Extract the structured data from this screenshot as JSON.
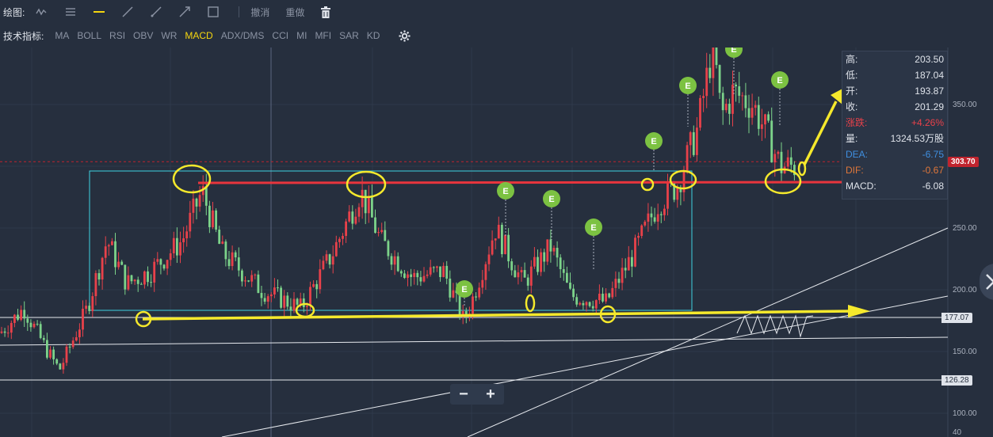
{
  "toolbar_draw": {
    "label": "绘图:",
    "tools": [
      {
        "name": "line-chart-icon"
      },
      {
        "name": "multi-line-icon"
      },
      {
        "name": "horizontal-line-icon",
        "active_color": "#f5d60f"
      },
      {
        "name": "trend-line-icon"
      },
      {
        "name": "ray-icon"
      },
      {
        "name": "arrow-line-icon"
      },
      {
        "name": "rectangle-icon"
      }
    ],
    "undo": "撤消",
    "redo": "重做",
    "delete_icon": "trash-icon"
  },
  "toolbar_indicators": {
    "label": "技术指标:",
    "items": [
      "MA",
      "BOLL",
      "RSI",
      "OBV",
      "WR",
      "MACD",
      "ADX/DMS",
      "CCI",
      "MI",
      "MFI",
      "SAR",
      "KD"
    ],
    "active": "MACD",
    "settings_icon": "gear-icon"
  },
  "info_panel": {
    "rows": [
      {
        "k": "高:",
        "v": "203.50",
        "kc": "#dfe3ea",
        "vc": "#dfe3ea"
      },
      {
        "k": "低:",
        "v": "187.04",
        "kc": "#dfe3ea",
        "vc": "#dfe3ea"
      },
      {
        "k": "开:",
        "v": "193.87",
        "kc": "#dfe3ea",
        "vc": "#dfe3ea"
      },
      {
        "k": "收:",
        "v": "201.29",
        "kc": "#dfe3ea",
        "vc": "#dfe3ea"
      },
      {
        "k": "涨跌:",
        "v": "+4.26%",
        "kc": "#e8414a",
        "vc": "#e8414a"
      },
      {
        "k": "量:",
        "v": "1324.53万股",
        "kc": "#dfe3ea",
        "vc": "#dfe3ea"
      },
      {
        "k": "DEA:",
        "v": "-6.75",
        "kc": "#3f8fe0",
        "vc": "#3f8fe0"
      },
      {
        "k": "DIF:",
        "v": "-0.67",
        "kc": "#e0773a",
        "vc": "#e0773a"
      },
      {
        "k": "MACD:",
        "v": "-6.08",
        "kc": "#dfe3ea",
        "vc": "#dfe3ea"
      }
    ]
  },
  "price_tags": {
    "current": "303.70",
    "support1": "177.07",
    "support2": "126.28"
  },
  "zoom": {
    "minus": "−",
    "plus": "+"
  },
  "colors": {
    "up": "#e8414a",
    "down": "#7cd38a",
    "annotation": "#f5e92c",
    "box": "#3fd0e0",
    "earnings_badge": "#7cc242",
    "background": "#262f3e"
  },
  "chart_data": {
    "type": "candlestick",
    "y_axis": {
      "ticks": [
        40,
        100,
        150,
        200,
        250,
        350
      ],
      "ylim": [
        40,
        420
      ],
      "scale": "log"
    },
    "grid": true,
    "earnings_markers": [
      {
        "label": "E",
        "index": 36
      },
      {
        "label": "E",
        "index": 78
      },
      {
        "label": "E",
        "index": 87
      },
      {
        "label": "E",
        "index": 93
      },
      {
        "label": "E",
        "index": 103
      },
      {
        "label": "E",
        "index": 108
      },
      {
        "label": "E",
        "index": 115
      },
      {
        "label": "E",
        "index": 122
      }
    ],
    "levels": [
      177.07,
      126.28,
      303.7
    ]
  }
}
